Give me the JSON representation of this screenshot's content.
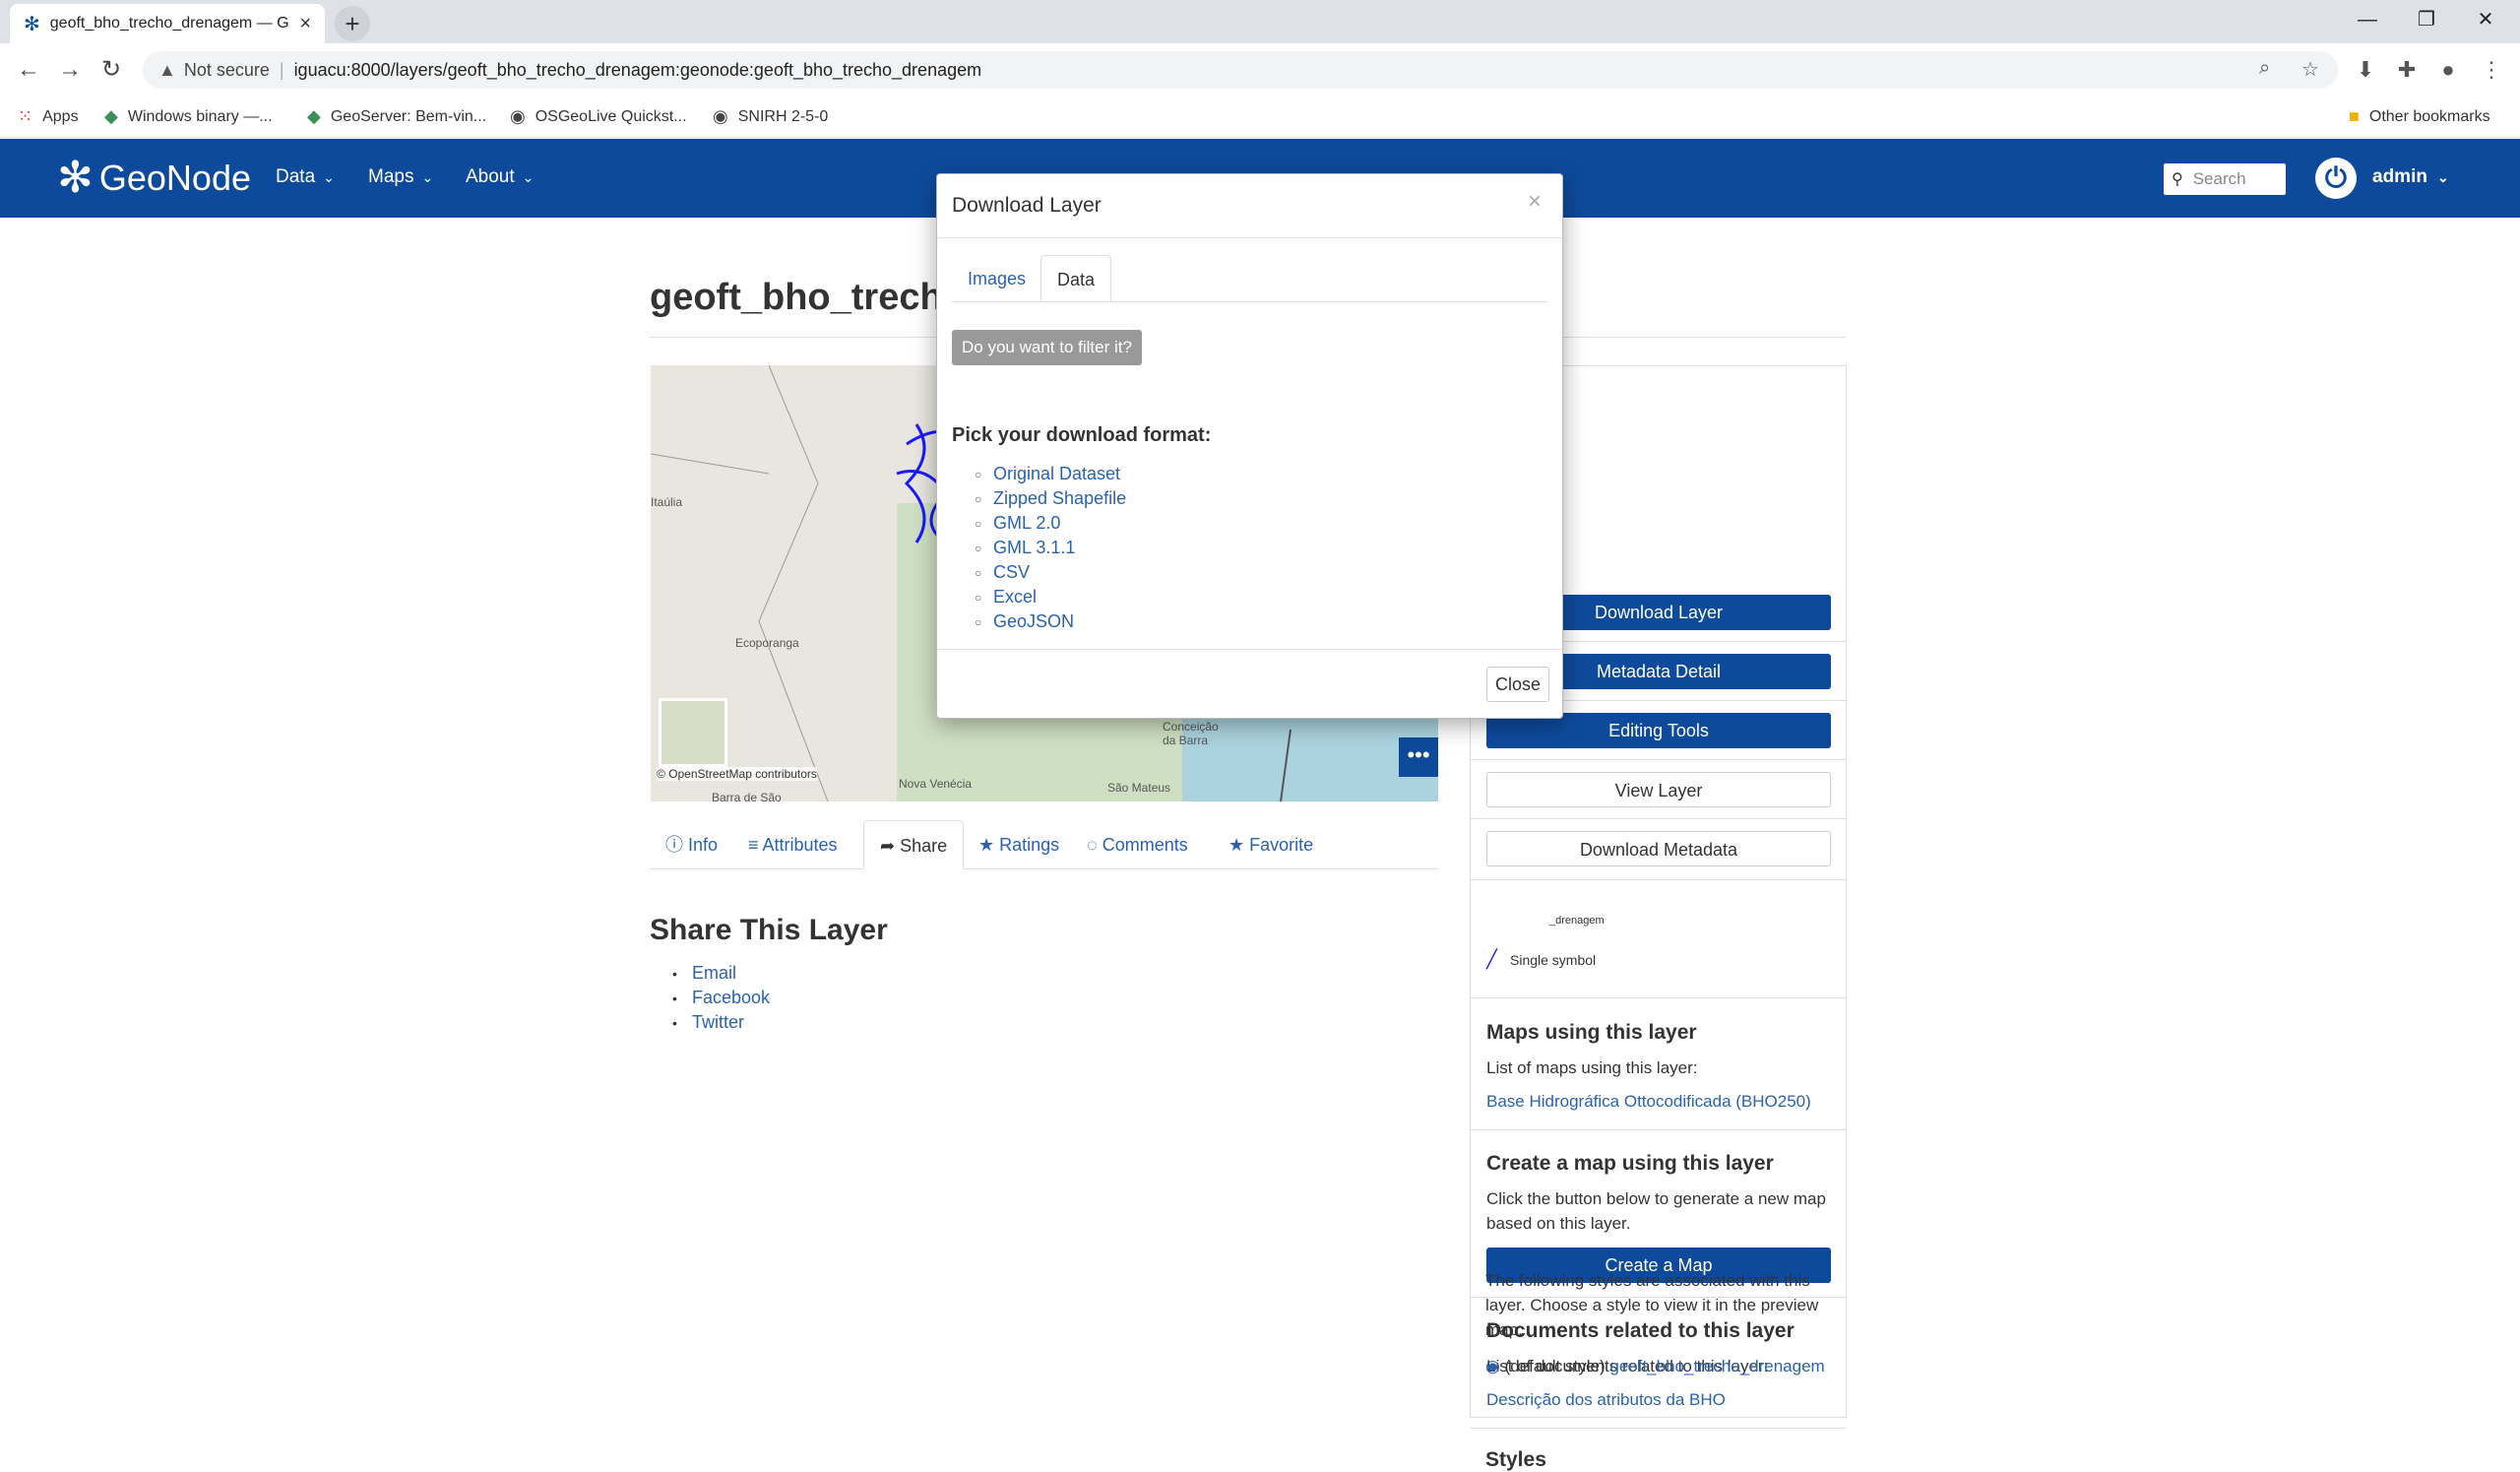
{
  "browser": {
    "tab_title": "geoft_bho_trecho_drenagem — G",
    "new_tab_symbol": "+",
    "close_tab_symbol": "×",
    "not_secure": "Not secure",
    "url": "iguacu:8000/layers/geoft_bho_trecho_drenagem:geonode:geoft_bho_trecho_drenagem",
    "bookmarks": {
      "apps": "Apps",
      "items": [
        "Windows binary —...",
        "GeoServer: Bem-vin...",
        "OSGeoLive Quickst...",
        "SNIRH 2-5-0"
      ],
      "other": "Other bookmarks"
    }
  },
  "navbar": {
    "brand": "GeoNode",
    "menu": [
      "Data",
      "Maps",
      "About"
    ],
    "search_placeholder": "Search",
    "user": "admin"
  },
  "layer": {
    "title": "geoft_bho_trecho_",
    "map_credit": "© OpenStreetMap contributors",
    "map_labels": [
      "Ecoporanga",
      "Nova Venécia",
      "São Mateus",
      "Barra de São",
      "Conceição da Barra",
      "Itaúlia"
    ],
    "tabs": [
      "Info",
      "Attributes",
      "Share",
      "Ratings",
      "Comments",
      "Favorite"
    ],
    "active_tab": "Share",
    "share_title": "Share This Layer",
    "share_links": [
      "Email",
      "Facebook",
      "Twitter"
    ]
  },
  "sidebar": {
    "buttons": [
      "Download Layer",
      "Metadata Detail",
      "Editing Tools",
      "View Layer",
      "Download Metadata"
    ],
    "legend_layer": "_drenagem",
    "legend_symbol": "Single symbol",
    "maps_heading": "Maps using this layer",
    "maps_text": "List of maps using this layer:",
    "maps_link": "Base Hidrográfica Ottocodificada (BHO250)",
    "create_heading": "Create a map using this layer",
    "create_text": "Click the button below to generate a new map based on this layer.",
    "create_button": "Create a Map",
    "docs_heading": "Documents related to this layer",
    "docs_text": "List of documents related to this layer:",
    "docs_link": "Descrição dos atributos da BHO",
    "styles_heading": "Styles",
    "styles_text": "The following styles are associated with this layer. Choose a style to view it in the preview map.",
    "style_default_label": "(default style)",
    "style_default_link": "geoft_bho_trecho_drenagem"
  },
  "modal": {
    "title": "Download Layer",
    "close_x": "×",
    "tabs": [
      "Images",
      "Data"
    ],
    "active_tab": "Data",
    "filter_button": "Do you want to filter it?",
    "pick_heading": "Pick your download format:",
    "formats": [
      "Original Dataset",
      "Zipped Shapefile",
      "GML 2.0",
      "GML 3.1.1",
      "CSV",
      "Excel",
      "GeoJSON"
    ],
    "close_button": "Close"
  },
  "colors": {
    "brand_blue": "#0e4a9c",
    "link_blue": "#2a62b0",
    "drainage_blue": "#1a1aff"
  }
}
